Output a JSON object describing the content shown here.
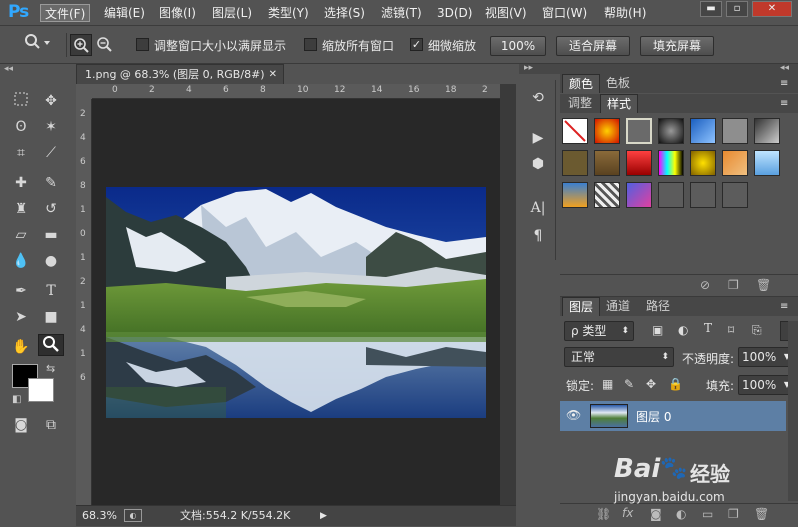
{
  "app": {
    "logo": "Ps"
  },
  "menu": [
    "文件(F)",
    "编辑(E)",
    "图像(I)",
    "图层(L)",
    "类型(Y)",
    "选择(S)",
    "滤镜(T)",
    "3D(D)",
    "视图(V)",
    "窗口(W)",
    "帮助(H)"
  ],
  "window_controls": {
    "minimize": "▬",
    "restore": "▫",
    "close": "✕"
  },
  "options": {
    "resize_windows": "调整窗口大小以满屏显示",
    "zoom_all": "缩放所有窗口",
    "scrubby_zoom": "细微缩放",
    "zoom_100": "100%",
    "fit_screen": "适合屏幕",
    "fill_screen": "填充屏幕"
  },
  "document": {
    "tab": "1.png @ 68.3% (图层 0, RGB/8#)",
    "zoom": "68.3%",
    "doc_info": "文档:554.2 K/554.2K"
  },
  "ruler_top": [
    "0",
    "2",
    "4",
    "6",
    "8",
    "10",
    "12",
    "14",
    "16",
    "18",
    "2"
  ],
  "ruler_left": [
    "2",
    "4",
    "6",
    "8",
    "1",
    "0",
    "1",
    "2",
    "1",
    "4",
    "1",
    "6"
  ],
  "panels": {
    "color_tabs": [
      "颜色",
      "色板"
    ],
    "style_tabs": [
      "调整",
      "样式"
    ],
    "layers_tabs": [
      "图层",
      "通道",
      "路径"
    ]
  },
  "layers": {
    "filter_kind": "ρ 类型",
    "blend_mode": "正常",
    "opacity_label": "不透明度:",
    "opacity_value": "100%",
    "lock_label": "锁定:",
    "fill_label": "填充:",
    "fill_value": "100%",
    "layer_name": "图层 0"
  },
  "watermark": {
    "brand": "Bai",
    "brand2": "经验",
    "url": "jingyan.baidu.com"
  },
  "colors": {
    "accent": "#31a8ff",
    "layer_selected": "#5d7fa5",
    "canvas_bg": "#282828"
  }
}
